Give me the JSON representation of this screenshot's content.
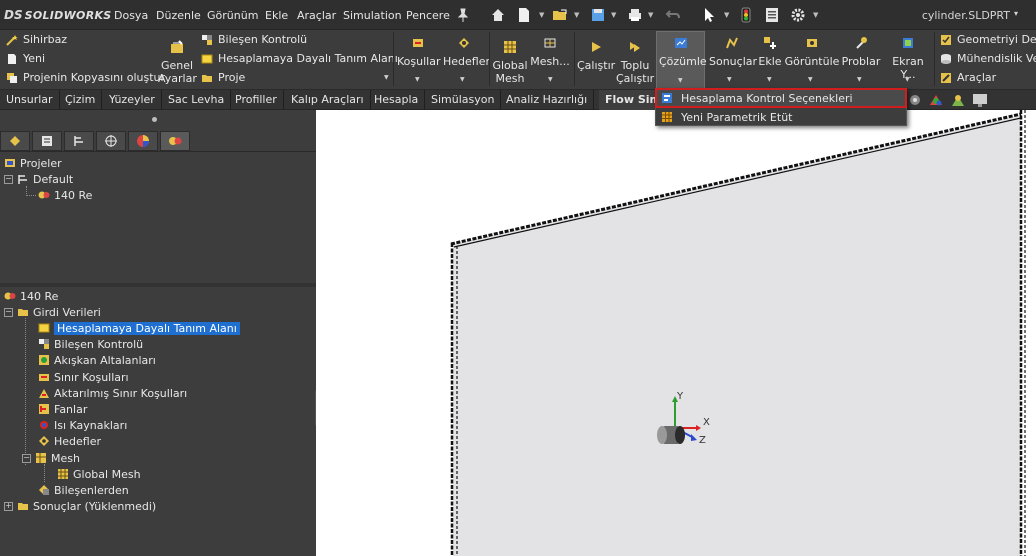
{
  "app": {
    "logo_ds": "DS",
    "logo_name": "SOLIDWORKS",
    "document": "cylinder.SLDPRT",
    "document_caret": "▾"
  },
  "menu": [
    "Dosya",
    "Düzenle",
    "Görünüm",
    "Ekle",
    "Araçlar",
    "Simulation",
    "Pencere"
  ],
  "ribbon": {
    "wizard": "Sihirbaz",
    "new": "Yeni",
    "clone": "Projenin Kopyasını oluştur",
    "general_settings_1": "Genel",
    "general_settings_2": "Ayarlar",
    "component_control": "Bileşen Kontrolü",
    "computational_domain": "Hesaplamaya Dayalı Tanım Alanı",
    "project": "Proje",
    "conditions": "Koşullar",
    "goals": "Hedefler",
    "global_mesh_1": "Global",
    "global_mesh_2": "Mesh",
    "mesh": "Mesh...",
    "run": "Çalıştır",
    "batch_run_1": "Toplu",
    "batch_run_2": "Çalıştır",
    "solve": "Çözümle",
    "results": "Sonuçlar",
    "insert": "Ekle",
    "display": "Görüntüle",
    "probes": "Problar",
    "screen": "Ekran Y...",
    "geometry_check": "Geometriyi Dene",
    "engineering": "Mühendislik Ver",
    "tools": "Araçlar"
  },
  "tabs": [
    "Unsurlar",
    "Çizim",
    "Yüzeyler",
    "Sac Levha",
    "Profiller",
    "Kalıp Araçları",
    "Hesapla",
    "Simülasyon",
    "Analiz Hazırlığı",
    "Flow Sim"
  ],
  "dropdown": {
    "item1": "Hesaplama Kontrol Seçenekleri",
    "item2": "Yeni Parametrik Etüt"
  },
  "project_tree": {
    "root": "Projeler",
    "default": "Default",
    "study": "140 Re"
  },
  "analysis_tree": {
    "root": "140 Re",
    "input_data": "Girdi Verileri",
    "items": [
      "Hesaplamaya Dayalı Tanım Alanı",
      "Bileşen Kontrolü",
      "Akışkan Altalanları",
      "Sınır Koşulları",
      "Aktarılmış Sınır Koşulları",
      "Fanlar",
      "Isı Kaynakları",
      "Hedefler"
    ],
    "mesh": "Mesh",
    "global_mesh": "Global Mesh",
    "from_components": "Bileşenlerden",
    "results": "Sonuçlar (Yüklenmedi)"
  },
  "triad": {
    "x": "X",
    "y": "Y",
    "z": "Z"
  },
  "colors": {
    "accent_red": "#d11d1d",
    "selection_blue": "#1e6fd0"
  }
}
